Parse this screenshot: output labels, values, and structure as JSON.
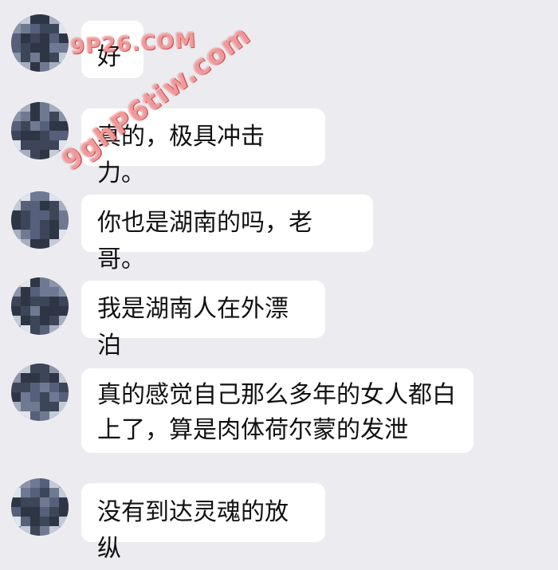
{
  "messages": [
    {
      "text": "好"
    },
    {
      "text": "真的，极具冲击力。"
    },
    {
      "text": "你也是湖南的吗，老哥。"
    },
    {
      "text": "我是湖南人在外漂泊"
    },
    {
      "text": "真的感觉自己那么多年的女人都白\n上了，算是肉体荷尔蒙的发泄"
    },
    {
      "text": "没有到达灵魂的放纵"
    }
  ],
  "watermarks": {
    "top": "9P26.COM",
    "diagonal": "9ghP6tiw.com"
  },
  "colors": {
    "background": "#ececf0",
    "bubble": "#ffffff",
    "text": "#111111",
    "watermark_outline": "#dc3c3c"
  }
}
